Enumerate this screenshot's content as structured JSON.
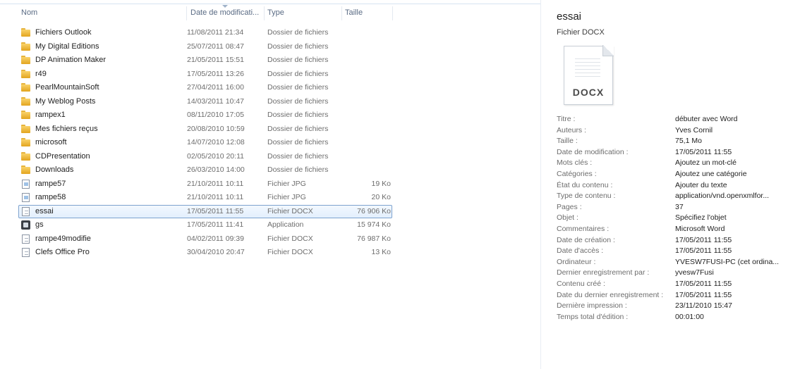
{
  "columns": {
    "name": "Nom",
    "date": "Date de modificati...",
    "type": "Type",
    "size": "Taille"
  },
  "files": [
    {
      "name": "Fichiers Outlook",
      "date": "11/08/2011 21:34",
      "type": "Dossier de fichiers",
      "size": "",
      "icon": "folder-icon"
    },
    {
      "name": "My Digital Editions",
      "date": "25/07/2011 08:47",
      "type": "Dossier de fichiers",
      "size": "",
      "icon": "folder-icon"
    },
    {
      "name": "DP Animation Maker",
      "date": "21/05/2011 15:51",
      "type": "Dossier de fichiers",
      "size": "",
      "icon": "folder-icon"
    },
    {
      "name": "r49",
      "date": "17/05/2011 13:26",
      "type": "Dossier de fichiers",
      "size": "",
      "icon": "folder-icon"
    },
    {
      "name": "PearlMountainSoft",
      "date": "27/04/2011 16:00",
      "type": "Dossier de fichiers",
      "size": "",
      "icon": "folder-icon"
    },
    {
      "name": "My Weblog Posts",
      "date": "14/03/2011 10:47",
      "type": "Dossier de fichiers",
      "size": "",
      "icon": "folder-icon"
    },
    {
      "name": "rampex1",
      "date": "08/11/2010 17:05",
      "type": "Dossier de fichiers",
      "size": "",
      "icon": "folder-icon"
    },
    {
      "name": "Mes fichiers reçus",
      "date": "20/08/2010 10:59",
      "type": "Dossier de fichiers",
      "size": "",
      "icon": "folder-icon"
    },
    {
      "name": "microsoft",
      "date": "14/07/2010 12:08",
      "type": "Dossier de fichiers",
      "size": "",
      "icon": "folder-icon"
    },
    {
      "name": "CDPresentation",
      "date": "02/05/2010 20:11",
      "type": "Dossier de fichiers",
      "size": "",
      "icon": "folder-icon"
    },
    {
      "name": "Downloads",
      "date": "26/03/2010 14:00",
      "type": "Dossier de fichiers",
      "size": "",
      "icon": "folder-icon"
    },
    {
      "name": "rampe57",
      "date": "21/10/2011 10:11",
      "type": "Fichier JPG",
      "size": "19 Ko",
      "icon": "image-file-icon"
    },
    {
      "name": "rampe58",
      "date": "21/10/2011 10:11",
      "type": "Fichier JPG",
      "size": "20 Ko",
      "icon": "image-file-icon"
    },
    {
      "name": "essai",
      "date": "17/05/2011 11:55",
      "type": "Fichier DOCX",
      "size": "76 906 Ko",
      "icon": "document-icon",
      "selected": true
    },
    {
      "name": "gs",
      "date": "17/05/2011 11:41",
      "type": "Application",
      "size": "15 974 Ko",
      "icon": "application-icon"
    },
    {
      "name": "rampe49modifie",
      "date": "04/02/2011 09:39",
      "type": "Fichier DOCX",
      "size": "76 987 Ko",
      "icon": "document-icon"
    },
    {
      "name": "Clefs Office Pro",
      "date": "30/04/2010 20:47",
      "type": "Fichier DOCX",
      "size": "13 Ko",
      "icon": "document-icon"
    }
  ],
  "details": {
    "title": "essai",
    "subtitle": "Fichier DOCX",
    "thumbnail_label": "DOCX",
    "properties": [
      {
        "label": "Titre :",
        "value": "débuter avec Word"
      },
      {
        "label": "Auteurs :",
        "value": "Yves Cornil"
      },
      {
        "label": "Taille :",
        "value": "75,1 Mo"
      },
      {
        "label": "Date de modification :",
        "value": "17/05/2011 11:55"
      },
      {
        "label": "Mots clés :",
        "value": "Ajoutez un mot-clé"
      },
      {
        "label": "Catégories :",
        "value": "Ajoutez une catégorie"
      },
      {
        "label": "État du contenu :",
        "value": "Ajouter du texte"
      },
      {
        "label": "Type de contenu :",
        "value": "application/vnd.openxmlfor..."
      },
      {
        "label": "Pages :",
        "value": "37"
      },
      {
        "label": "Objet :",
        "value": "Spécifiez l'objet"
      },
      {
        "label": "Commentaires :",
        "value": "Microsoft Word"
      },
      {
        "label": "Date de création :",
        "value": "17/05/2011 11:55"
      },
      {
        "label": "Date d'accès :",
        "value": "17/05/2011 11:55"
      },
      {
        "label": "Ordinateur :",
        "value": "YVESW7FUSI-PC (cet ordina..."
      },
      {
        "label": "Dernier enregistrement par :",
        "value": "yvesw7Fusi"
      },
      {
        "label": "Contenu créé :",
        "value": "17/05/2011 11:55"
      },
      {
        "label": "Date du dernier enregistrement :",
        "value": "17/05/2011 11:55"
      },
      {
        "label": "Dernière impression :",
        "value": "23/11/2010 15:47"
      },
      {
        "label": "Temps total d'édition :",
        "value": "00:01:00"
      }
    ]
  },
  "colors": {
    "selection_border": "#7da2ce",
    "header_text": "#5a6b84",
    "secondary_text": "#6d6d6d"
  }
}
